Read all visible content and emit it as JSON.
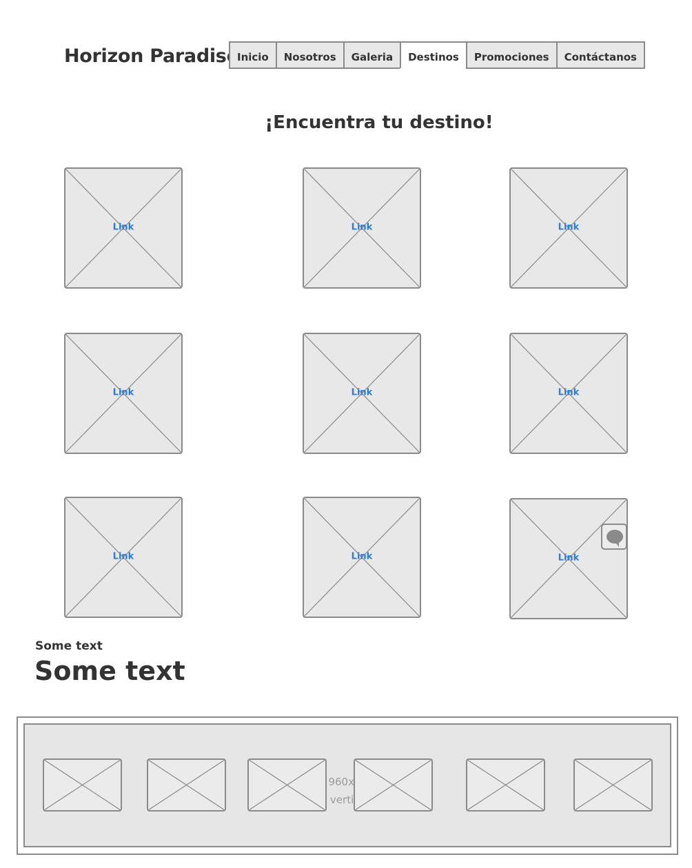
{
  "header": {
    "brand": "Horizon Paradise",
    "tabs": [
      {
        "label": "Inicio"
      },
      {
        "label": "Nosotros"
      },
      {
        "label": "Galeria"
      },
      {
        "label": "Destinos",
        "active": true
      },
      {
        "label": "Promociones"
      },
      {
        "label": "Contáctanos"
      }
    ]
  },
  "main": {
    "headline": "¡Encuentra tu destino!",
    "destinations": [
      {
        "link": "Link"
      },
      {
        "link": "Link"
      },
      {
        "link": "Link"
      },
      {
        "link": "Link"
      },
      {
        "link": "Link"
      },
      {
        "link": "Link"
      },
      {
        "link": "Link"
      },
      {
        "link": "Link"
      },
      {
        "link": "Link"
      }
    ],
    "small_text": "Some text",
    "large_text": "Some text"
  },
  "footer_ad": {
    "line1": "960x2",
    "line2": "vertis"
  },
  "colors": {
    "link": "#2f7bd1",
    "border": "#8a8a8a",
    "placeholder_fill": "#e8e8e8",
    "text": "#333333"
  },
  "icons": [
    "chat-bubble-icon"
  ]
}
